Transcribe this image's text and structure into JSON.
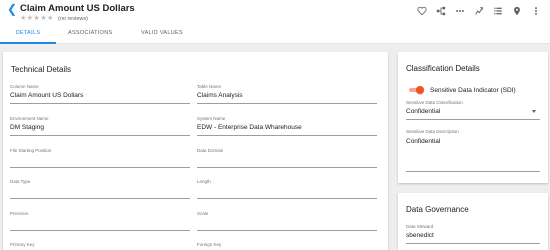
{
  "header": {
    "title": "Claim Amount US Dollars",
    "stars": "★★★★★",
    "reviews": "(no reviews)",
    "actions": [
      "heart-icon",
      "lineage-icon",
      "more-horizontal-icon",
      "share-icon",
      "list-icon",
      "location-icon",
      "more-vertical-icon"
    ]
  },
  "tabs": [
    {
      "label": "DETAILS",
      "active": true
    },
    {
      "label": "ASSOCIATIONS",
      "active": false
    },
    {
      "label": "VALID VALUES",
      "active": false
    }
  ],
  "technical": {
    "title": "Technical Details",
    "fields": [
      {
        "label": "Column Name",
        "value": "Claim Amount US Dollars"
      },
      {
        "label": "Table Name",
        "value": "Claims Analysis"
      },
      {
        "label": "Environment Name",
        "value": "DM Staging"
      },
      {
        "label": "System Name",
        "value": "EDW - Enterprise Data Wharehouse"
      },
      {
        "label": "File Starting Position",
        "value": ""
      },
      {
        "label": "Data Domain",
        "value": ""
      },
      {
        "label": "Data Type",
        "value": ""
      },
      {
        "label": "Length",
        "value": ""
      },
      {
        "label": "Precision",
        "value": ""
      },
      {
        "label": "Scale",
        "value": ""
      },
      {
        "label": "Primary Key",
        "value": ""
      },
      {
        "label": "Foreign Key",
        "value": ""
      }
    ]
  },
  "classification": {
    "title": "Classification Details",
    "sdi_label": "Sensitive Data Indicator (SDI)",
    "sdi_on": true,
    "sdc_label": "Sensitive Data Classification",
    "sdc_value": "Confidential",
    "desc_label": "Sensitive Data Description",
    "desc_value": "Confidential"
  },
  "governance": {
    "title": "Data Governance",
    "steward_label": "Data Steward",
    "steward_value": "sbenedict"
  },
  "colors": {
    "accent": "#1e88e5",
    "toggle": "#f4511e"
  }
}
